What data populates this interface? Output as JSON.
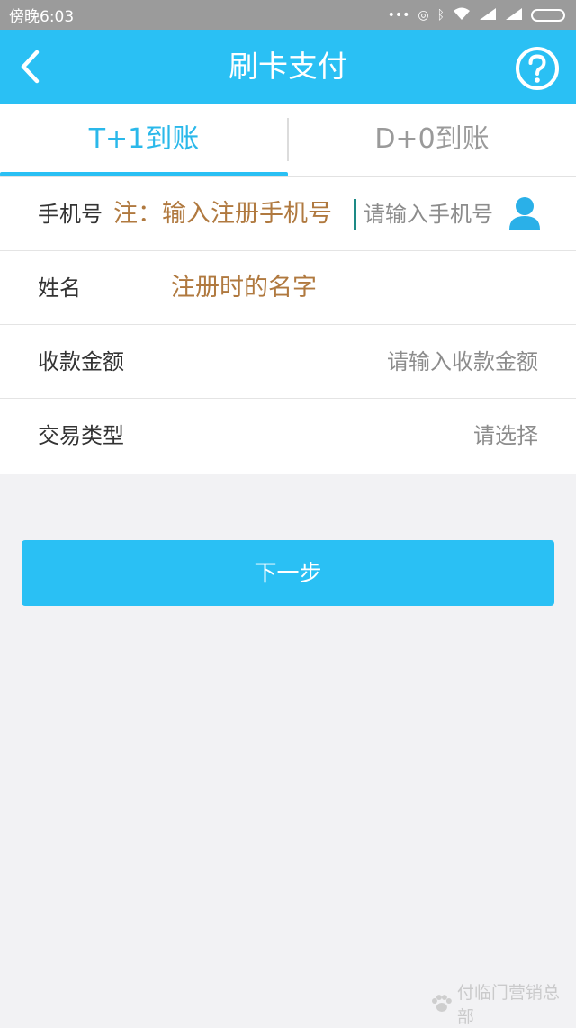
{
  "status_bar": {
    "time": "傍晚6:03"
  },
  "nav": {
    "title": "刷卡支付",
    "back_icon": "chevron-left-icon",
    "help_icon": "question-circle-icon"
  },
  "tabs": [
    {
      "label": "T+1到账",
      "selected": true
    },
    {
      "label": "D+0到账",
      "selected": false
    }
  ],
  "form": {
    "phone": {
      "label": "手机号",
      "hint": "注：输入注册手机号",
      "placeholder": "请输入手机号",
      "icon": "contact-person-icon"
    },
    "name": {
      "label": "姓名",
      "hint": "注册时的名字"
    },
    "amount": {
      "label": "收款金额",
      "placeholder": "请输入收款金额"
    },
    "type": {
      "label": "交易类型",
      "placeholder": "请选择"
    }
  },
  "actions": {
    "next_label": "下一步"
  },
  "watermark": {
    "text": "付临门营销总部"
  },
  "colors": {
    "accent": "#2ac0f4",
    "hint": "#b0793f",
    "status_bar": "#9b9b9b"
  }
}
